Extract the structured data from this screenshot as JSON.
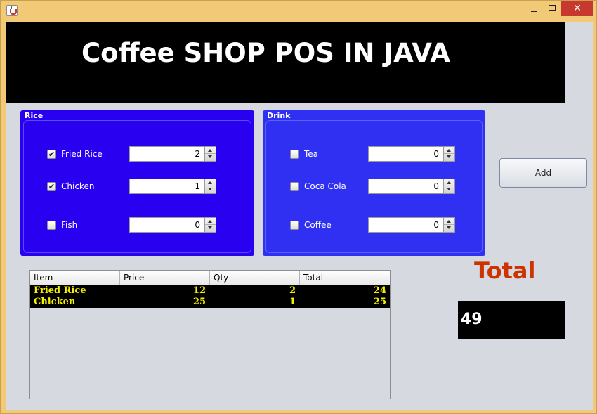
{
  "window": {
    "title": "",
    "close_label": "✕"
  },
  "banner": {
    "title": "Coffee SHOP POS IN JAVA"
  },
  "rice_panel": {
    "title": "Rice",
    "items": [
      {
        "label": "Fried Rice",
        "checked": true,
        "qty": "2"
      },
      {
        "label": "Chicken",
        "checked": true,
        "qty": "1"
      },
      {
        "label": "Fish",
        "checked": false,
        "qty": "0"
      }
    ]
  },
  "drink_panel": {
    "title": "Drink",
    "items": [
      {
        "label": "Tea",
        "checked": false,
        "qty": "0"
      },
      {
        "label": "Coca Cola",
        "checked": false,
        "qty": "0"
      },
      {
        "label": "Coffee",
        "checked": false,
        "qty": "0"
      }
    ]
  },
  "add_button": {
    "label": "Add"
  },
  "order_table": {
    "columns": [
      "Item",
      "Price",
      "Qty",
      "Total"
    ],
    "rows": [
      {
        "item": "Fried Rice",
        "price": "12",
        "qty": "2",
        "total": "24"
      },
      {
        "item": "Chicken",
        "price": "25",
        "qty": "1",
        "total": "25"
      }
    ]
  },
  "total": {
    "label": "Total",
    "value": "49"
  },
  "colors": {
    "rice_panel_bg": "#2a00f0",
    "drink_panel_bg": "#3030f2",
    "table_text": "#f5f000",
    "total_label": "#cc3300"
  }
}
